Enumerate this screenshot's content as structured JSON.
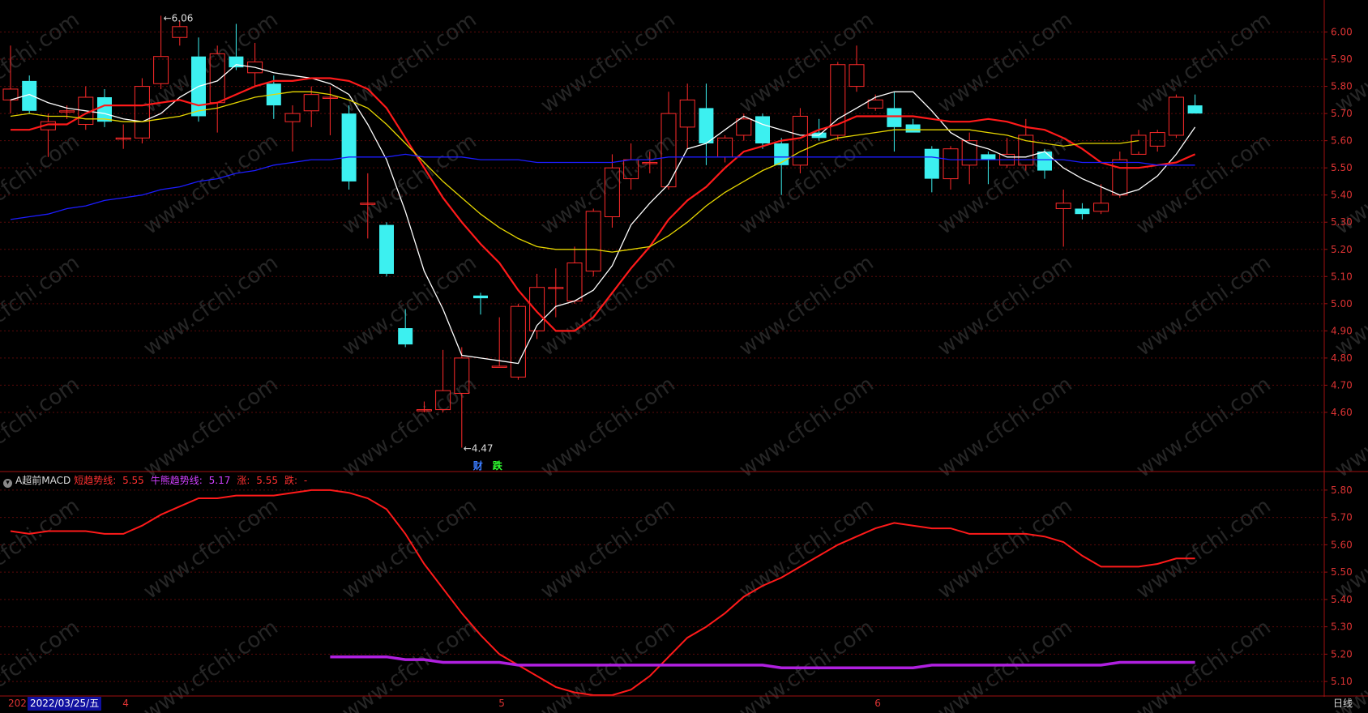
{
  "chart_data": [
    {
      "type": "candlestick",
      "title": "",
      "ylim": [
        4.4,
        6.1
      ],
      "yticks": [
        "6.00",
        "5.90",
        "5.80",
        "5.70",
        "5.60",
        "5.50",
        "5.40",
        "5.30",
        "5.20",
        "5.10",
        "5.00",
        "4.90",
        "4.80",
        "4.70",
        "4.60"
      ],
      "candles": [
        {
          "o": 5.75,
          "c": 5.79,
          "h": 5.95,
          "l": 5.7
        },
        {
          "o": 5.82,
          "c": 5.71,
          "h": 5.84,
          "l": 5.7
        },
        {
          "o": 5.64,
          "c": 5.67,
          "h": 5.7,
          "l": 5.54
        },
        {
          "o": 5.71,
          "c": 5.71,
          "h": 5.73,
          "l": 5.68
        },
        {
          "o": 5.66,
          "c": 5.76,
          "h": 5.8,
          "l": 5.64
        },
        {
          "o": 5.76,
          "c": 5.67,
          "h": 5.79,
          "l": 5.65
        },
        {
          "o": 5.61,
          "c": 5.61,
          "h": 5.66,
          "l": 5.57
        },
        {
          "o": 5.61,
          "c": 5.8,
          "h": 5.83,
          "l": 5.59
        },
        {
          "o": 5.81,
          "c": 5.91,
          "h": 6.06,
          "l": 5.79
        },
        {
          "o": 5.98,
          "c": 6.02,
          "h": 6.04,
          "l": 5.95
        },
        {
          "o": 5.91,
          "c": 5.69,
          "h": 5.98,
          "l": 5.67
        },
        {
          "o": 5.74,
          "c": 5.92,
          "h": 5.95,
          "l": 5.63
        },
        {
          "o": 5.91,
          "c": 5.87,
          "h": 6.03,
          "l": 5.86
        },
        {
          "o": 5.85,
          "c": 5.89,
          "h": 5.96,
          "l": 5.8
        },
        {
          "o": 5.81,
          "c": 5.73,
          "h": 5.84,
          "l": 5.68
        },
        {
          "o": 5.67,
          "c": 5.7,
          "h": 5.73,
          "l": 5.56
        },
        {
          "o": 5.71,
          "c": 5.77,
          "h": 5.8,
          "l": 5.65
        },
        {
          "o": 5.76,
          "c": 5.76,
          "h": 5.8,
          "l": 5.62
        },
        {
          "o": 5.7,
          "c": 5.45,
          "h": 5.73,
          "l": 5.42
        },
        {
          "o": 5.37,
          "c": 5.37,
          "h": 5.48,
          "l": 5.24
        },
        {
          "o": 5.29,
          "c": 5.11,
          "h": 5.3,
          "l": 5.1
        },
        {
          "o": 4.91,
          "c": 4.85,
          "h": 4.98,
          "l": 4.84
        },
        {
          "o": 4.61,
          "c": 4.61,
          "h": 4.64,
          "l": 4.6
        },
        {
          "o": 4.61,
          "c": 4.68,
          "h": 4.83,
          "l": 4.6
        },
        {
          "o": 4.67,
          "c": 4.8,
          "h": 4.84,
          "l": 4.47
        },
        {
          "o": 5.03,
          "c": 5.02,
          "h": 5.04,
          "l": 4.96
        },
        {
          "o": 4.77,
          "c": 4.77,
          "h": 4.95,
          "l": 4.77
        },
        {
          "o": 4.73,
          "c": 4.99,
          "h": 5.0,
          "l": 4.72
        },
        {
          "o": 4.9,
          "c": 5.06,
          "h": 5.11,
          "l": 4.87
        },
        {
          "o": 5.06,
          "c": 5.06,
          "h": 5.13,
          "l": 4.95
        },
        {
          "o": 5.01,
          "c": 5.15,
          "h": 5.21,
          "l": 5.0
        },
        {
          "o": 5.12,
          "c": 5.34,
          "h": 5.35,
          "l": 5.1
        },
        {
          "o": 5.32,
          "c": 5.5,
          "h": 5.55,
          "l": 5.28
        },
        {
          "o": 5.46,
          "c": 5.53,
          "h": 5.59,
          "l": 5.42
        },
        {
          "o": 5.52,
          "c": 5.52,
          "h": 5.56,
          "l": 5.48
        },
        {
          "o": 5.43,
          "c": 5.7,
          "h": 5.78,
          "l": 5.42
        },
        {
          "o": 5.65,
          "c": 5.75,
          "h": 5.81,
          "l": 5.57
        },
        {
          "o": 5.72,
          "c": 5.59,
          "h": 5.81,
          "l": 5.51
        },
        {
          "o": 5.54,
          "c": 5.61,
          "h": 5.62,
          "l": 5.52
        },
        {
          "o": 5.62,
          "c": 5.68,
          "h": 5.7,
          "l": 5.6
        },
        {
          "o": 5.69,
          "c": 5.59,
          "h": 5.7,
          "l": 5.57
        },
        {
          "o": 5.59,
          "c": 5.51,
          "h": 5.61,
          "l": 5.4
        },
        {
          "o": 5.51,
          "c": 5.69,
          "h": 5.72,
          "l": 5.48
        },
        {
          "o": 5.63,
          "c": 5.61,
          "h": 5.68,
          "l": 5.6
        },
        {
          "o": 5.62,
          "c": 5.88,
          "h": 5.89,
          "l": 5.6
        },
        {
          "o": 5.8,
          "c": 5.88,
          "h": 5.95,
          "l": 5.78
        },
        {
          "o": 5.72,
          "c": 5.75,
          "h": 5.77,
          "l": 5.71
        },
        {
          "o": 5.72,
          "c": 5.65,
          "h": 5.78,
          "l": 5.56
        },
        {
          "o": 5.66,
          "c": 5.63,
          "h": 5.68,
          "l": 5.63
        },
        {
          "o": 5.57,
          "c": 5.46,
          "h": 5.58,
          "l": 5.41
        },
        {
          "o": 5.46,
          "c": 5.57,
          "h": 5.58,
          "l": 5.42
        },
        {
          "o": 5.51,
          "c": 5.6,
          "h": 5.63,
          "l": 5.44
        },
        {
          "o": 5.55,
          "c": 5.53,
          "h": 5.56,
          "l": 5.44
        },
        {
          "o": 5.51,
          "c": 5.55,
          "h": 5.61,
          "l": 5.5
        },
        {
          "o": 5.51,
          "c": 5.62,
          "h": 5.68,
          "l": 5.49
        },
        {
          "o": 5.56,
          "c": 5.49,
          "h": 5.57,
          "l": 5.46
        },
        {
          "o": 5.35,
          "c": 5.37,
          "h": 5.42,
          "l": 5.21
        },
        {
          "o": 5.35,
          "c": 5.33,
          "h": 5.37,
          "l": 5.31
        },
        {
          "o": 5.34,
          "c": 5.37,
          "h": 5.44,
          "l": 5.33
        },
        {
          "o": 5.4,
          "c": 5.53,
          "h": 5.56,
          "l": 5.39
        },
        {
          "o": 5.55,
          "c": 5.62,
          "h": 5.64,
          "l": 5.56
        },
        {
          "o": 5.58,
          "c": 5.63,
          "h": 5.64,
          "l": 5.56
        },
        {
          "o": 5.62,
          "c": 5.76,
          "h": 5.77,
          "l": 5.61
        },
        {
          "o": 5.73,
          "c": 5.7,
          "h": 5.77,
          "l": 5.7
        }
      ],
      "ma_lines": [
        {
          "color": "#ffffff",
          "values": [
            5.75,
            5.77,
            5.74,
            5.72,
            5.71,
            5.7,
            5.68,
            5.67,
            5.7,
            5.76,
            5.8,
            5.82,
            5.88,
            5.87,
            5.85,
            5.84,
            5.83,
            5.81,
            5.77,
            5.66,
            5.53,
            5.34,
            5.12,
            4.98,
            4.81,
            4.8,
            4.79,
            4.78,
            4.92,
            4.99,
            5.01,
            5.05,
            5.14,
            5.29,
            5.37,
            5.44,
            5.57,
            5.59,
            5.64,
            5.69,
            5.66,
            5.64,
            5.62,
            5.62,
            5.68,
            5.72,
            5.76,
            5.78,
            5.78,
            5.71,
            5.63,
            5.59,
            5.57,
            5.54,
            5.54,
            5.56,
            5.5,
            5.46,
            5.43,
            5.4,
            5.42,
            5.47,
            5.55,
            5.65
          ]
        },
        {
          "color": "#ff1a1a",
          "values": [
            5.64,
            5.64,
            5.66,
            5.66,
            5.7,
            5.73,
            5.73,
            5.73,
            5.74,
            5.75,
            5.73,
            5.74,
            5.77,
            5.8,
            5.82,
            5.82,
            5.83,
            5.83,
            5.82,
            5.79,
            5.72,
            5.61,
            5.5,
            5.39,
            5.3,
            5.22,
            5.15,
            5.05,
            4.97,
            4.9,
            4.9,
            4.95,
            5.04,
            5.13,
            5.21,
            5.31,
            5.38,
            5.43,
            5.5,
            5.56,
            5.58,
            5.6,
            5.61,
            5.64,
            5.66,
            5.69,
            5.69,
            5.69,
            5.69,
            5.68,
            5.67,
            5.67,
            5.68,
            5.67,
            5.65,
            5.64,
            5.61,
            5.57,
            5.52,
            5.5,
            5.5,
            5.51,
            5.52,
            5.55
          ]
        },
        {
          "color": "#e6d600",
          "values": [
            5.69,
            5.7,
            5.69,
            5.69,
            5.68,
            5.68,
            5.67,
            5.67,
            5.68,
            5.69,
            5.71,
            5.72,
            5.74,
            5.76,
            5.77,
            5.78,
            5.78,
            5.77,
            5.75,
            5.72,
            5.66,
            5.59,
            5.52,
            5.45,
            5.39,
            5.33,
            5.28,
            5.24,
            5.21,
            5.2,
            5.2,
            5.2,
            5.19,
            5.2,
            5.21,
            5.25,
            5.3,
            5.36,
            5.41,
            5.45,
            5.49,
            5.52,
            5.56,
            5.59,
            5.61,
            5.62,
            5.63,
            5.64,
            5.64,
            5.64,
            5.64,
            5.64,
            5.63,
            5.62,
            5.6,
            5.59,
            5.58,
            5.59,
            5.59,
            5.59,
            5.6
          ]
        },
        {
          "color": "#1c1cff",
          "values": [
            5.31,
            5.32,
            5.33,
            5.35,
            5.36,
            5.38,
            5.39,
            5.4,
            5.42,
            5.43,
            5.45,
            5.46,
            5.48,
            5.49,
            5.51,
            5.52,
            5.53,
            5.53,
            5.54,
            5.54,
            5.54,
            5.55,
            5.54,
            5.54,
            5.54,
            5.53,
            5.53,
            5.53,
            5.52,
            5.52,
            5.52,
            5.52,
            5.52,
            5.53,
            5.53,
            5.54,
            5.54,
            5.54,
            5.54,
            5.54,
            5.54,
            5.54,
            5.54,
            5.54,
            5.54,
            5.54,
            5.54,
            5.54,
            5.54,
            5.54,
            5.53,
            5.53,
            5.53,
            5.53,
            5.53,
            5.53,
            5.53,
            5.52,
            5.52,
            5.52,
            5.52,
            5.51,
            5.51,
            5.51
          ]
        }
      ],
      "high_label": "6.06",
      "low_label": "4.47"
    },
    {
      "type": "line",
      "title": "A超前MACD",
      "ylim": [
        5.05,
        5.85
      ],
      "yticks": [
        "5.80",
        "5.70",
        "5.60",
        "5.50",
        "5.40",
        "5.30",
        "5.20",
        "5.10"
      ],
      "legend": [
        {
          "label": "短趋势线:",
          "value": "5.55",
          "color": "#ff3030"
        },
        {
          "label": "牛熊趋势线:",
          "value": "5.17",
          "color": "#d040ff"
        },
        {
          "label": "涨:",
          "value": "5.55",
          "color": "#ff3030"
        },
        {
          "label": "跌:",
          "value": "-",
          "color": "#ff3030"
        }
      ],
      "series": [
        {
          "color": "#ff1a1a",
          "start": 0,
          "values": [
            5.65,
            5.64,
            5.65,
            5.65,
            5.65,
            5.64,
            5.64,
            5.67,
            5.71,
            5.74,
            5.77,
            5.77,
            5.78,
            5.78,
            5.78,
            5.79,
            5.8,
            5.8,
            5.79,
            5.77,
            5.73,
            5.64,
            5.53,
            5.44,
            5.35,
            5.27,
            5.2,
            5.16,
            5.12,
            5.08,
            5.06,
            5.05,
            5.05,
            5.07,
            5.12,
            5.19,
            5.26,
            5.3,
            5.35,
            5.41,
            5.45,
            5.48,
            5.52,
            5.56,
            5.6,
            5.63,
            5.66,
            5.68,
            5.67,
            5.66,
            5.66,
            5.64,
            5.64,
            5.64,
            5.64,
            5.63,
            5.61,
            5.56,
            5.52,
            5.52,
            5.52,
            5.53,
            5.55,
            5.55
          ]
        },
        {
          "color": "#b020e0",
          "start": 17,
          "values": [
            5.19,
            5.19,
            5.19,
            5.19,
            5.18,
            5.18,
            5.17,
            5.17,
            5.17,
            5.17,
            5.16,
            5.16,
            5.16,
            5.16,
            5.16,
            5.16,
            5.16,
            5.16,
            5.16,
            5.16,
            5.16,
            5.16,
            5.16,
            5.16,
            5.15,
            5.15,
            5.15,
            5.15,
            5.15,
            5.15,
            5.15,
            5.15,
            5.16,
            5.16,
            5.16,
            5.16,
            5.16,
            5.16,
            5.16,
            5.16,
            5.16,
            5.16,
            5.17,
            5.17,
            5.17,
            5.17,
            5.17
          ]
        }
      ],
      "event_tags": [
        {
          "text": "财",
          "color": "#3b7cff"
        },
        {
          "text": "跌",
          "color": "#30ff30"
        }
      ]
    }
  ],
  "x_axis": {
    "year_stub": "202",
    "date_box": "2022/03/25/五",
    "months": [
      {
        "text": "4",
        "index": 6
      },
      {
        "text": "5",
        "index": 26
      },
      {
        "text": "6",
        "index": 46
      }
    ],
    "period": "日线"
  },
  "watermark": "www.cfchi.com"
}
